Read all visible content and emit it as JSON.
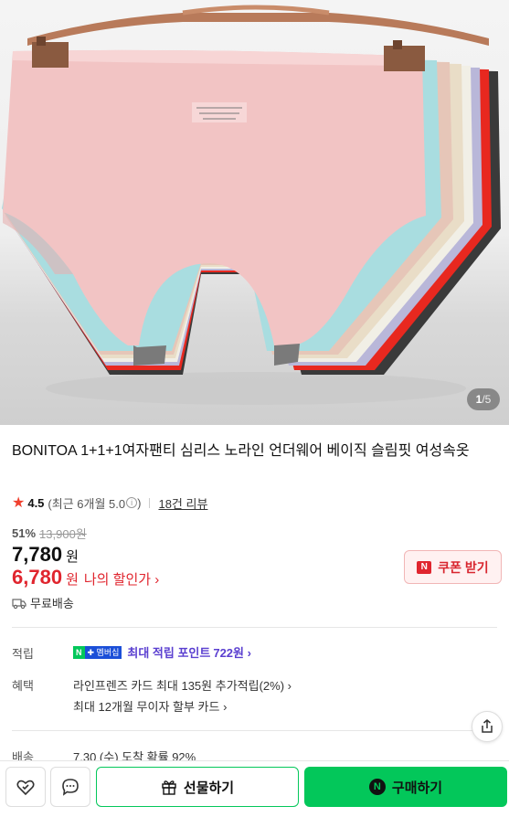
{
  "gallery": {
    "current": "1",
    "total": "5",
    "separator": "/"
  },
  "product": {
    "title": "BONITOA 1+1+1여자팬티 심리스 노라인 언더웨어 베이직 슬림핏 여성속옷",
    "rating": "4.5",
    "rating_sub": "(최근 6개월 5.0",
    "rating_sub_end": ")",
    "review_link": "18건 리뷰"
  },
  "price": {
    "discount_rate": "51%",
    "original": "13,900원",
    "sale": "7,780",
    "sale_unit": "원",
    "my_price": "6,780",
    "my_unit": "원",
    "my_label": "나의 할인가 ›"
  },
  "coupon": {
    "label": "쿠폰 받기",
    "badge": "N"
  },
  "shipping": {
    "text": "무료배송"
  },
  "info": {
    "points_label": "적립",
    "points_badge_g": "N",
    "points_badge_p": "✚ 멤버십",
    "points_text": "최대 적립 포인트",
    "points_value": "722원 ›",
    "benefit_label": "혜택",
    "benefit_1": "라인프렌즈 카드 최대 135원 추가적립(2%) ›",
    "benefit_2": "최대 12개월 무이자 할부 카드 ›",
    "delivery_label": "배송",
    "delivery_value": "7.30 (수) 도착 확률 92%"
  },
  "actions": {
    "gift": "선물하기",
    "buy": "구매하기",
    "buy_badge": "N"
  },
  "colors": {
    "naver_green": "#03c75a",
    "sale_red": "#e0252e",
    "point_purple": "#5a3fd0",
    "panty_pink": "#f2c4c4"
  },
  "icons": [
    "star-icon",
    "info-icon",
    "truck-icon",
    "share-icon",
    "wishlist-icon",
    "chat-icon",
    "gift-icon"
  ]
}
